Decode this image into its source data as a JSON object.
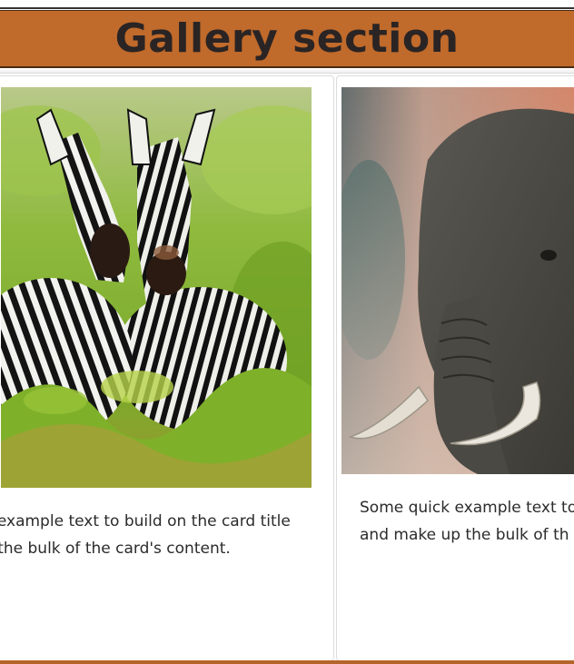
{
  "header": {
    "title": "Gallery section"
  },
  "colors": {
    "header_bg": "#c06a2b",
    "header_text": "#2a2424",
    "accent_bar": "#b5652a"
  },
  "cards": [
    {
      "image": "zebras-photo",
      "text_lines": [
        "e example text to build on the card title",
        "p the bulk of the card's content."
      ]
    },
    {
      "image": "elephant-photo",
      "text_lines": [
        "Some quick example text to",
        "and make up the bulk of th"
      ]
    }
  ]
}
